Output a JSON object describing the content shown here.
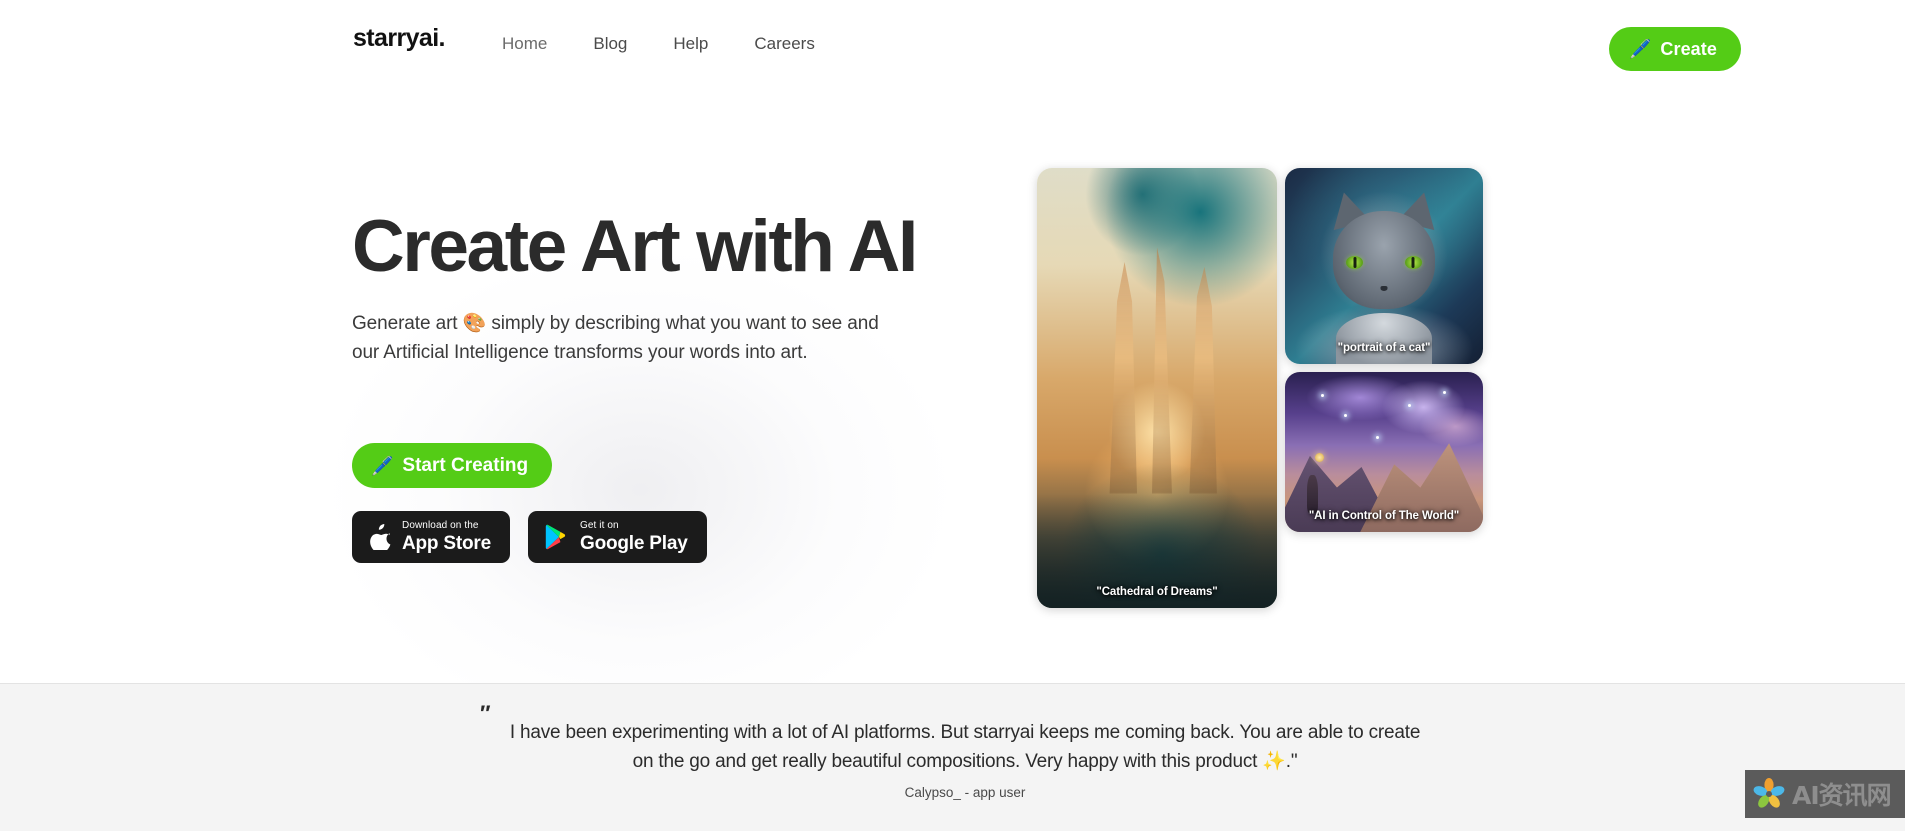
{
  "nav": {
    "logo": "starryai",
    "logo_dot": ".",
    "links": [
      {
        "label": "Home"
      },
      {
        "label": "Blog"
      },
      {
        "label": "Help"
      },
      {
        "label": "Careers"
      }
    ],
    "create_button": {
      "label": "Create",
      "icon": "pencil-emoji",
      "glyph": "🖊️",
      "color": "#54cc16"
    }
  },
  "hero": {
    "headline": "Create Art with AI",
    "subtitle": "Generate art 🎨 simply by describing what you want to see and our Artificial Intelligence transforms your words into art.",
    "start_button": {
      "label": "Start Creating",
      "glyph": "🖊️",
      "color": "#54cc16"
    },
    "stores": [
      {
        "small": "Download on the",
        "big": "App Store",
        "icon": "apple-icon"
      },
      {
        "small": "Get it on",
        "big": "Google Play",
        "icon": "google-play-icon"
      }
    ]
  },
  "gallery": {
    "cards": [
      {
        "caption": "\"Cathedral of Dreams\""
      },
      {
        "caption": "\"portrait of a cat\""
      },
      {
        "caption": "\"AI in Control of The World\""
      }
    ]
  },
  "testimonial": {
    "quote_mark": "″",
    "quote": "I have been experimenting with a lot of AI platforms. But starryai keeps me coming back. You are able to create on the go and get really beautiful compositions. Very happy with this product ✨.\"",
    "author": "Calypso_ - app user"
  },
  "watermark": {
    "text": "AI资讯网"
  }
}
